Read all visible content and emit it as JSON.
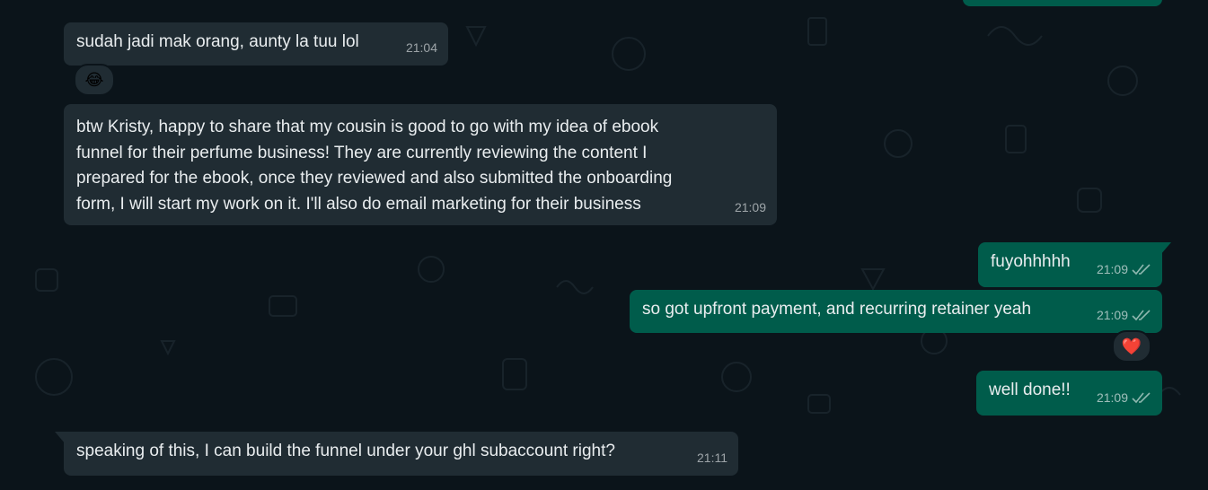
{
  "chat": {
    "messages": [
      {
        "direction": "in",
        "text": "sudah jadi mak orang, aunty la tuu lol",
        "time": "21:04",
        "reaction": "😂"
      },
      {
        "direction": "in",
        "text": "btw Kristy, happy to share that my cousin is good to go with my idea of ebook\nfunnel for their perfume business! They are currently reviewing the content I\nprepared for the ebook, once they reviewed and also submitted the onboarding\nform, I will start my work on it. I'll also do email marketing for their business",
        "time": "21:09"
      },
      {
        "direction": "out",
        "text": "fuyohhhhh",
        "time": "21:09",
        "status": "read"
      },
      {
        "direction": "out",
        "text": "so got upfront payment, and recurring retainer yeah",
        "time": "21:09",
        "status": "read",
        "reaction": "❤️"
      },
      {
        "direction": "out",
        "text": "well done!!",
        "time": "21:09",
        "status": "read"
      },
      {
        "direction": "in",
        "text": "speaking of this, I can build the funnel under your ghl subaccount right?",
        "time": "21:11"
      }
    ]
  },
  "colors": {
    "background": "#0b141a",
    "incoming_bubble": "#202c33",
    "outgoing_bubble": "#005c4b",
    "text": "#e9edef",
    "read_ticks": "#8fb8b0"
  }
}
